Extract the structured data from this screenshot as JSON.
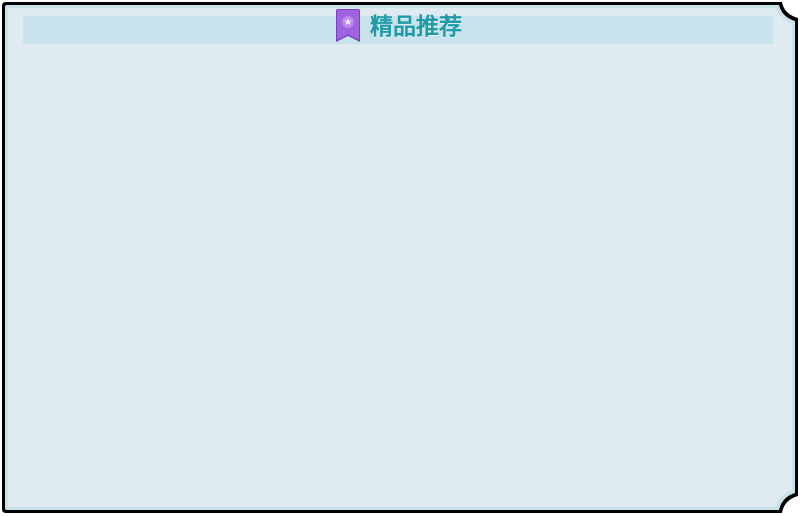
{
  "panel": {
    "title": "精品推荐",
    "title_icon": "bookmark-star-icon"
  },
  "colors": {
    "panel_bg": "#dfebf1",
    "header_bg": "#c8e3ec",
    "border": "#000000",
    "inner_border": "#b9d8e3",
    "title_text": "#1f9aa6",
    "icon_fill": "#9a5ad6"
  }
}
